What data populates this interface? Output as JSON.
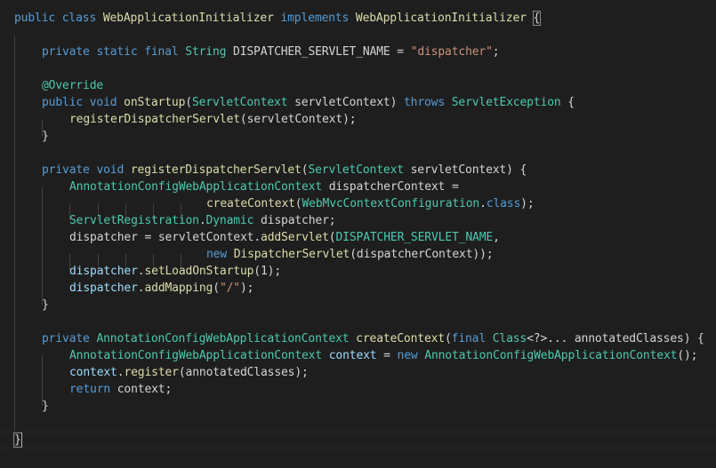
{
  "editor": {
    "lines": {
      "l1": [
        "public",
        "class",
        "WebApplicationInitializer",
        "implements",
        "WebApplicationInitializer",
        "{"
      ],
      "l3": [
        "private",
        "static",
        "final",
        "String",
        "DISPATCHER_SERVLET_NAME",
        "=",
        "\"dispatcher\"",
        ";"
      ],
      "l5": [
        "@Override"
      ],
      "l6": [
        "public",
        "void",
        "onStartup",
        "(",
        "ServletContext",
        "servletContext",
        ")",
        "throws",
        "ServletException",
        "{"
      ],
      "l7": [
        "registerDispatcherServlet",
        "(servletContext);"
      ],
      "l8": [
        "}"
      ],
      "l10": [
        "private",
        "void",
        "registerDispatcherServlet",
        "(",
        "ServletContext",
        "servletContext",
        ") {"
      ],
      "l11": [
        "AnnotationConfigWebApplicationContext",
        "dispatcherContext",
        "="
      ],
      "l12": [
        "createContext",
        "(",
        "WebMvcContextConfiguration",
        ".",
        "class",
        ");"
      ],
      "l13": [
        "ServletRegistration",
        ".",
        "Dynamic",
        "dispatcher;"
      ],
      "l14": [
        "dispatcher",
        "=",
        "servletContext",
        ".",
        "addServlet",
        "(",
        "DISPATCHER_SERVLET_NAME",
        ","
      ],
      "l15": [
        "new",
        "DispatcherServlet",
        "(dispatcherContext));"
      ],
      "l16": [
        "dispatcher",
        ".",
        "setLoadOnStartup",
        "(",
        "1",
        ");"
      ],
      "l17": [
        "dispatcher",
        ".",
        "addMapping",
        "(",
        "\"/\"",
        ");"
      ],
      "l18": [
        "}"
      ],
      "l20": [
        "private",
        "AnnotationConfigWebApplicationContext",
        "createContext",
        "(",
        "final",
        "Class",
        "<?>",
        "...",
        "annotatedClasses",
        ") {"
      ],
      "l21": [
        "AnnotationConfigWebApplicationContext",
        "context",
        "=",
        "new",
        "AnnotationConfigWebApplicationContext",
        "();"
      ],
      "l22": [
        "context",
        ".",
        "register",
        "(annotatedClasses);"
      ],
      "l23": [
        "return",
        "context;"
      ],
      "l24": [
        "}"
      ],
      "l26": [
        "}"
      ]
    }
  }
}
